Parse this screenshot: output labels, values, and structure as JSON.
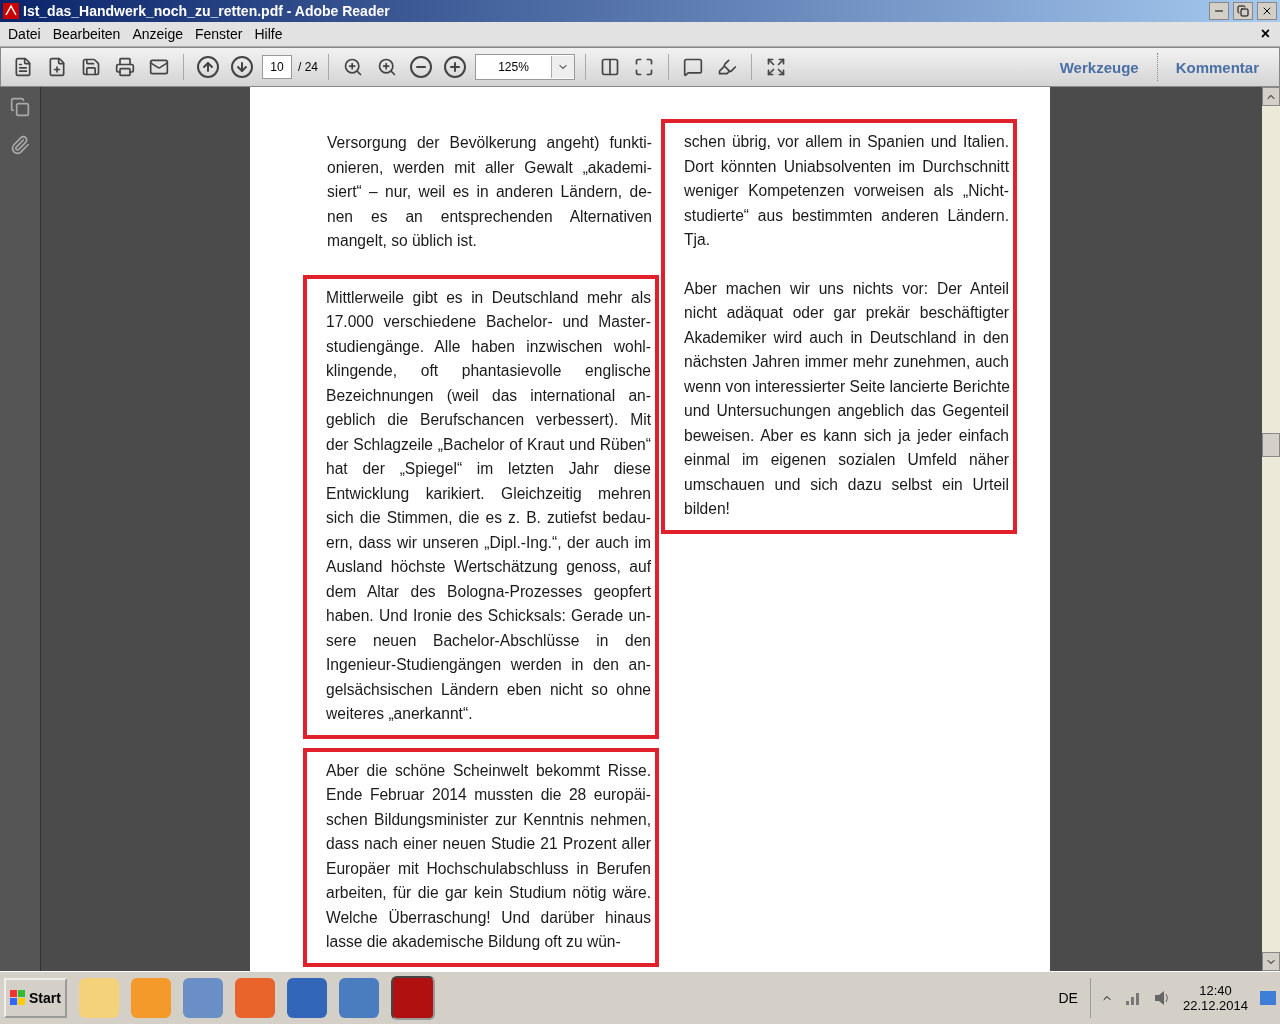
{
  "window": {
    "title": "Ist_das_Handwerk_noch_zu_retten.pdf - Adobe Reader"
  },
  "menu": [
    {
      "label": "Datei"
    },
    {
      "label": "Bearbeiten"
    },
    {
      "label": "Anzeige"
    },
    {
      "label": "Fenster"
    },
    {
      "label": "Hilfe"
    }
  ],
  "menu_close": "×",
  "toolbar": {
    "page": "10",
    "page_total": "/ 24",
    "zoom": "125%",
    "links": [
      {
        "label": "Werkzeuge"
      },
      {
        "label": "Kommentar"
      }
    ]
  },
  "document": {
    "columns": [
      {
        "blocks": [
          {
            "boxed": false,
            "paragraphs": [
              [
                "Versorgung der Bevölkerung angeht) funkti-",
                "onieren, werden mit aller Gewalt „akademi-",
                "siert“ – nur, weil es in anderen Ländern, de-",
                "nen es an entsprechenden Alternativen",
                "mangelt, so üblich ist."
              ]
            ]
          },
          {
            "boxed": true,
            "paragraphs": [
              [
                "Mittlerweile gibt es in Deutschland mehr als",
                "17.000 verschiedene Bachelor- und Master-",
                "studiengänge. Alle haben inzwischen wohl-",
                "klingende, oft phantasievolle englische",
                "Bezeichnungen (weil das international an-",
                "geblich die Berufschancen verbessert). Mit",
                "der Schlagzeile „Bachelor of Kraut und Rüben“",
                "hat der „Spiegel“ im letzten Jahr diese",
                "Entwicklung karikiert. Gleichzeitig mehren",
                "sich die Stimmen, die es z. B. zutiefst bedau-",
                "ern, dass wir unseren „Dipl.-Ing.“, der auch im",
                "Ausland höchste Wertschätzung genoss, auf",
                "dem Altar des Bologna-Prozesses geopfert",
                "haben. Und Ironie des Schicksals: Gerade un-",
                "sere neuen Bachelor-Abschlüsse in den",
                "Ingenieur-Studiengängen werden in den an-",
                "gelsächsischen Ländern eben nicht so ohne",
                "weiteres „anerkannt“."
              ]
            ]
          },
          {
            "boxed": true,
            "paragraphs": [
              [
                "Aber die schöne Scheinwelt bekommt Risse.",
                "Ende Februar 2014 mussten die 28 europäi-",
                "schen Bildungsminister zur Kenntnis nehmen,",
                "dass nach einer neuen Studie 21 Prozent aller",
                "Europäer mit Hochschulabschluss in Berufen",
                "arbeiten, für die gar kein Studium nötig wäre.",
                "Welche Überraschung! Und darüber hinaus",
                "lasse die akademische Bildung oft zu wün-"
              ]
            ]
          }
        ]
      },
      {
        "blocks": [
          {
            "boxed": true,
            "paragraphs": [
              [
                "schen übrig, vor allem in Spanien und Italien.",
                "Dort könnten Uniabsolventen im Durchschnitt",
                "weniger Kompetenzen vorweisen als „Nicht-",
                "studierte“ aus bestimmten anderen Ländern.",
                "Tja."
              ],
              [
                "Aber machen wir uns nichts vor: Der Anteil",
                "nicht adäquat oder gar prekär beschäftigter",
                "Akademiker wird auch in Deutschland in den",
                "nächsten Jahren immer mehr zunehmen, auch",
                "wenn von interessierter Seite lancierte Berichte",
                "und Untersuchungen angeblich das Gegenteil",
                "beweisen. Aber es kann sich ja jeder einfach",
                "einmal im eigenen sozialen Umfeld näher",
                "umschauen und sich dazu selbst ein Urteil",
                "bilden!"
              ]
            ]
          }
        ]
      }
    ]
  },
  "taskbar": {
    "start": "Start",
    "language": "DE",
    "time": "12:40",
    "date": "22.12.2014"
  }
}
